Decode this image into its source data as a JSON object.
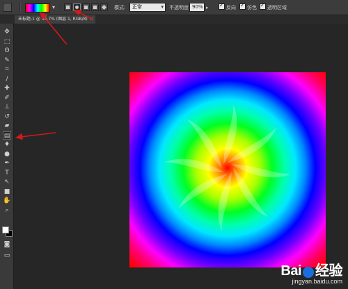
{
  "options_bar": {
    "mode_label": "模式:",
    "mode_value": "正常",
    "opacity_label": "不透明度:",
    "opacity_value": "90%",
    "reverse_label": "反向",
    "dither_label": "仿色",
    "transparency_label": "透明区域",
    "gradient_colors": [
      "#ff0000",
      "#ff00ff",
      "#0000ff",
      "#00ffff",
      "#00ff00",
      "#ffff00",
      "#ff0000"
    ]
  },
  "document_tab": {
    "title": "未标题-1 @ 66.7% (图层 1, RGB/8)",
    "close_glyph": "×"
  },
  "toolbar": {
    "tools": [
      {
        "icon": "move-icon",
        "glyph": "✥"
      },
      {
        "icon": "marquee-icon",
        "glyph": "⬚"
      },
      {
        "icon": "lasso-icon",
        "glyph": "ʘ"
      },
      {
        "icon": "quick-select-icon",
        "glyph": "✎"
      },
      {
        "icon": "crop-icon",
        "glyph": "⌗"
      },
      {
        "icon": "eyedropper-icon",
        "glyph": "∕"
      },
      {
        "icon": "healing-brush-icon",
        "glyph": "✚"
      },
      {
        "icon": "brush-icon",
        "glyph": "✐"
      },
      {
        "icon": "clone-stamp-icon",
        "glyph": "⊥"
      },
      {
        "icon": "history-brush-icon",
        "glyph": "↺"
      },
      {
        "icon": "eraser-icon",
        "glyph": "▰"
      },
      {
        "icon": "gradient-icon",
        "glyph": "▤"
      },
      {
        "icon": "blur-icon",
        "glyph": "♦"
      },
      {
        "icon": "dodge-icon",
        "glyph": "●"
      },
      {
        "icon": "pen-icon",
        "glyph": "✒"
      },
      {
        "icon": "type-icon",
        "glyph": "T"
      },
      {
        "icon": "path-select-icon",
        "glyph": "↖"
      },
      {
        "icon": "shape-icon",
        "glyph": "■"
      },
      {
        "icon": "hand-icon",
        "glyph": "✋"
      },
      {
        "icon": "zoom-icon",
        "glyph": "⌕"
      }
    ],
    "selected_tool": "gradient-icon",
    "foreground_color": "#ffffff",
    "background_color": "#000000"
  },
  "watermark": {
    "brand": "Bai",
    "brand_tail": "经验",
    "sub": "jingyan.baidu.com"
  },
  "annotation_color": "#d11a1a"
}
